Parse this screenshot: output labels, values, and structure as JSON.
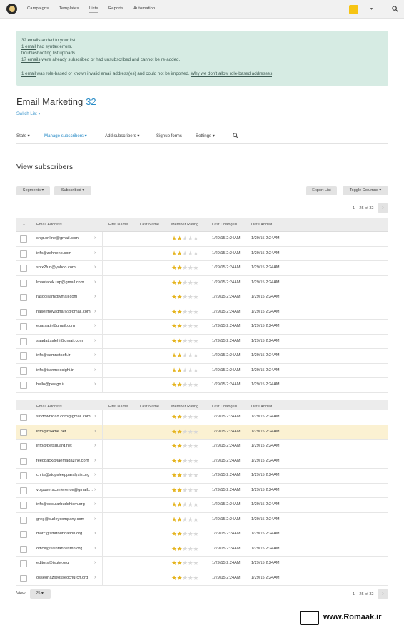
{
  "nav": {
    "items": [
      "Campaigns",
      "Templates",
      "Lists",
      "Reports",
      "Automation"
    ],
    "active": "Lists",
    "account_caret": "▾"
  },
  "notice": {
    "line1": "32 emails added to your list.",
    "line2_link": "1 email",
    "line2_rest": " had syntax errors.",
    "line3_link": "troubleshooting list uploads",
    "line4_link": "17 emails",
    "line4_rest": " were already subscribed or had unsubscribed and cannot be re-added.",
    "line5_link": "1 email",
    "line5_rest": " was role-based or known invalid email address(es) and could not be imported. ",
    "line5_link2": "Why we don't allow role-based addresses"
  },
  "page": {
    "title": "Email Marketing",
    "count": "32",
    "switch_list": "Switch List ▾"
  },
  "subnav": {
    "items": [
      "Stats ▾",
      "Manage subscribers ▾",
      "Add subscribers ▾",
      "Signup forms",
      "Settings ▾"
    ]
  },
  "view": {
    "heading": "View subscribers",
    "segments": "Segments ▾",
    "subscribed": "Subscribed ▾",
    "export": "Export List",
    "toggle": "Toggle Columns ▾",
    "pager": "1 – 25 of 32",
    "view_label": "View",
    "per_page": "25 ▾"
  },
  "columns": [
    "Email Address",
    "First Name",
    "Last Name",
    "Member Rating",
    "Last Changed",
    "Date Added"
  ],
  "rows": [
    {
      "email": "snip.online@gmail.com",
      "rating": 2,
      "changed": "1/29/15 2:24AM",
      "added": "1/29/15 2:24AM"
    },
    {
      "email": "info@zehneno.com",
      "rating": 2,
      "changed": "1/29/15 2:24AM",
      "added": "1/29/15 2:24AM"
    },
    {
      "email": "spix2fun@yahoo.com",
      "rating": 2,
      "changed": "1/29/15 2:24AM",
      "added": "1/29/15 2:24AM"
    },
    {
      "email": "lmantarek.rap@gmail.com",
      "rating": 2,
      "changed": "1/29/15 2:24AM",
      "added": "1/29/15 2:24AM"
    },
    {
      "email": "rasoolilam@ymail.com",
      "rating": 2,
      "changed": "1/29/15 2:24AM",
      "added": "1/29/15 2:24AM"
    },
    {
      "email": "nasermovaghari2@gmail.com",
      "rating": 2,
      "changed": "1/29/15 2:24AM",
      "added": "1/29/15 2:24AM"
    },
    {
      "email": "eparsa.ir@gmail.com",
      "rating": 2,
      "changed": "1/29/15 2:24AM",
      "added": "1/29/15 2:24AM"
    },
    {
      "email": "saadat.salehi@gmail.com",
      "rating": 2,
      "changed": "1/29/15 2:24AM",
      "added": "1/29/15 2:24AM"
    },
    {
      "email": "info@camnetsoft.ir",
      "rating": 2,
      "changed": "1/29/15 2:24AM",
      "added": "1/29/15 2:24AM"
    },
    {
      "email": "info@iranmoosighi.ir",
      "rating": 2,
      "changed": "1/29/15 2:24AM",
      "added": "1/29/15 2:24AM"
    },
    {
      "email": "hello@pesign.ir",
      "rating": 2,
      "changed": "1/29/15 2:24AM",
      "added": "1/29/15 2:24AM"
    }
  ],
  "rows2": [
    {
      "email": "sibdownload.com@gmail.com",
      "rating": 2,
      "changed": "1/29/15 2:24AM",
      "added": "1/29/15 2:24AM"
    },
    {
      "email": "info@ns4me.net",
      "rating": 2,
      "changed": "1/29/15 2:24AM",
      "added": "1/29/15 2:24AM",
      "highlight": true
    },
    {
      "email": "info@petsguard.net",
      "rating": 2,
      "changed": "1/29/15 2:24AM",
      "added": "1/29/15 2:24AM"
    },
    {
      "email": "feedback@iaemagazine.com",
      "rating": 2,
      "changed": "1/29/15 2:24AM",
      "added": "1/29/15 2:24AM"
    },
    {
      "email": "chris@stopsleepparalysis.org",
      "rating": 2,
      "changed": "1/29/15 2:24AM",
      "added": "1/29/15 2:24AM"
    },
    {
      "email": "voipusersconference@gmail.c...",
      "rating": 2,
      "changed": "1/29/15 2:24AM",
      "added": "1/29/15 2:24AM"
    },
    {
      "email": "info@secularbuddhism.org",
      "rating": 2,
      "changed": "1/29/15 2:24AM",
      "added": "1/29/15 2:24AM"
    },
    {
      "email": "greg@curleycompany.com",
      "rating": 2,
      "changed": "1/29/15 2:24AM",
      "added": "1/29/15 2:24AM"
    },
    {
      "email": "marc@smrfoundation.org",
      "rating": 2,
      "changed": "1/29/15 2:24AM",
      "added": "1/29/15 2:24AM"
    },
    {
      "email": "office@saintannesmn.org",
      "rating": 2,
      "changed": "1/29/15 2:24AM",
      "added": "1/29/15 2:24AM"
    },
    {
      "email": "editors@isgtw.org",
      "rating": 2,
      "changed": "1/29/15 2:24AM",
      "added": "1/29/15 2:24AM"
    },
    {
      "email": "osseonaz@osseochurch.org",
      "rating": 2,
      "changed": "1/29/15 2:24AM",
      "added": "1/29/15 2:24AM"
    }
  ],
  "rating_max": 5,
  "watermark": {
    "text": "www.Romaak.ir"
  },
  "colors": {
    "accent": "#2a8cc7",
    "notice_bg": "#d6ebe3",
    "star": "#e5b41f",
    "highlight": "#fbf1d2",
    "account": "#f6c413"
  }
}
